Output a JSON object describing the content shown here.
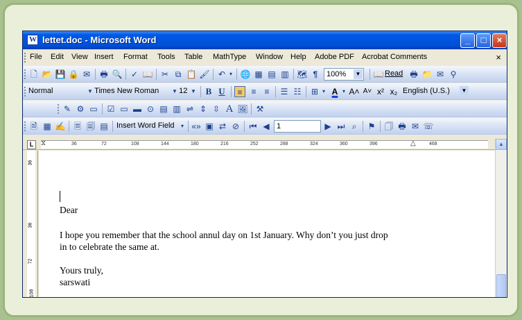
{
  "window": {
    "title": "lettet.doc - Microsoft Word",
    "min": "_",
    "max": "□",
    "close": "×"
  },
  "menu": [
    "File",
    "Edit",
    "View",
    "Insert",
    "Format",
    "Tools",
    "Table",
    "MathType",
    "Window",
    "Help",
    "Adobe PDF",
    "Acrobat Comments"
  ],
  "menu_close": "×",
  "standard": {
    "zoom": "100%",
    "read": "Read"
  },
  "formatting": {
    "style": "Normal",
    "font": "Times New Roman",
    "size": "12",
    "bold": "B",
    "underline": "U",
    "language": "English (U.S.)"
  },
  "forms": {
    "text": "A"
  },
  "mailmerge": {
    "insert_field": "Insert Word Field",
    "record": "1"
  },
  "ruler": {
    "ticks": [
      "36",
      "72",
      "108",
      "144",
      "180",
      "216",
      "252",
      "288",
      "324",
      "360",
      "396",
      "468"
    ],
    "tab_marker": "L"
  },
  "vruler": [
    "36",
    "36",
    "72",
    "108"
  ],
  "document": {
    "lines": [
      "Dear",
      "I hope you remember that the school annul day on 1st January. Why don’t you just drop",
      "in to celebrate the same at.",
      "Yours truly,",
      "sarswati"
    ]
  }
}
